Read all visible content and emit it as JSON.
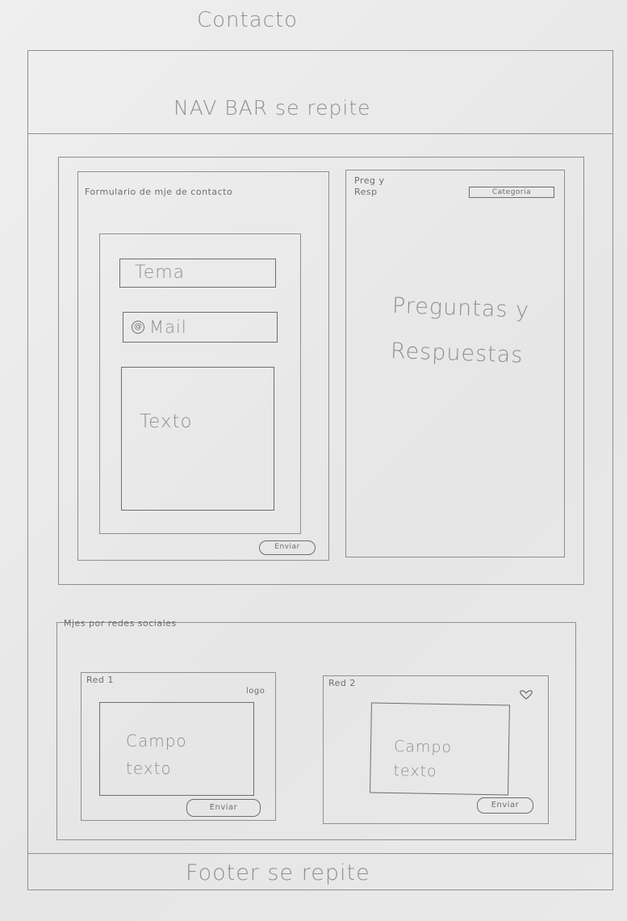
{
  "page": {
    "title": "Contacto"
  },
  "navbar": {
    "label": "NAV BAR se repite"
  },
  "contact_form": {
    "title": "Formulario de mje de contacto",
    "subject_placeholder": "Tema",
    "mail_placeholder": "Mail",
    "mail_icon": "at-icon",
    "text_placeholder": "Texto",
    "send_label": "Enviar"
  },
  "faq": {
    "title": "Preg y Resp",
    "category_label": "Categoria",
    "body": "Preguntas y Respuestas"
  },
  "social": {
    "title": "Mjes por redes sociales",
    "cards": [
      {
        "title": "Red 1",
        "logo_label": "logo",
        "field_text": "Campo texto",
        "send_label": "Enviar"
      },
      {
        "title": "Red 2",
        "logo_icon": "heart-icon",
        "field_text": "Campo texto",
        "send_label": "Enviar"
      }
    ]
  },
  "footer": {
    "label": "Footer se repite"
  }
}
